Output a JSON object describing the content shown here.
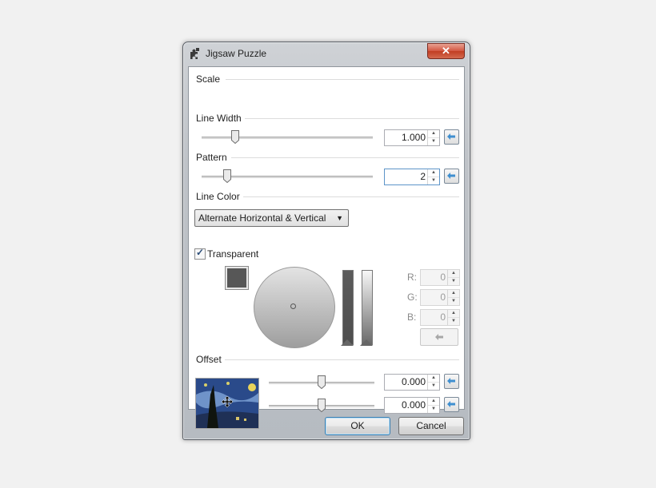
{
  "window": {
    "title": "Jigsaw Puzzle",
    "close_glyph": "✕",
    "icon": "puzzle-piece-icon"
  },
  "scale": {
    "label": "Scale",
    "value": "1.000",
    "slider_position": 0.18
  },
  "line_width": {
    "label": "Line Width",
    "value": "2",
    "slider_position": 0.13
  },
  "pattern": {
    "label": "Pattern",
    "selected": "Alternate Horizontal & Vertical"
  },
  "line_color": {
    "label": "Line Color",
    "transparent_label": "Transparent",
    "transparent_checked": true,
    "swatch_color": "#575757",
    "r_label": "R:",
    "r_value": "0",
    "g_label": "G:",
    "g_value": "0",
    "b_label": "B:",
    "b_value": "0"
  },
  "offset": {
    "label": "Offset",
    "x_value": "0.000",
    "y_value": "0.000",
    "x_slider_position": 0.5,
    "y_slider_position": 0.5
  },
  "buttons": {
    "ok": "OK",
    "cancel": "Cancel"
  }
}
